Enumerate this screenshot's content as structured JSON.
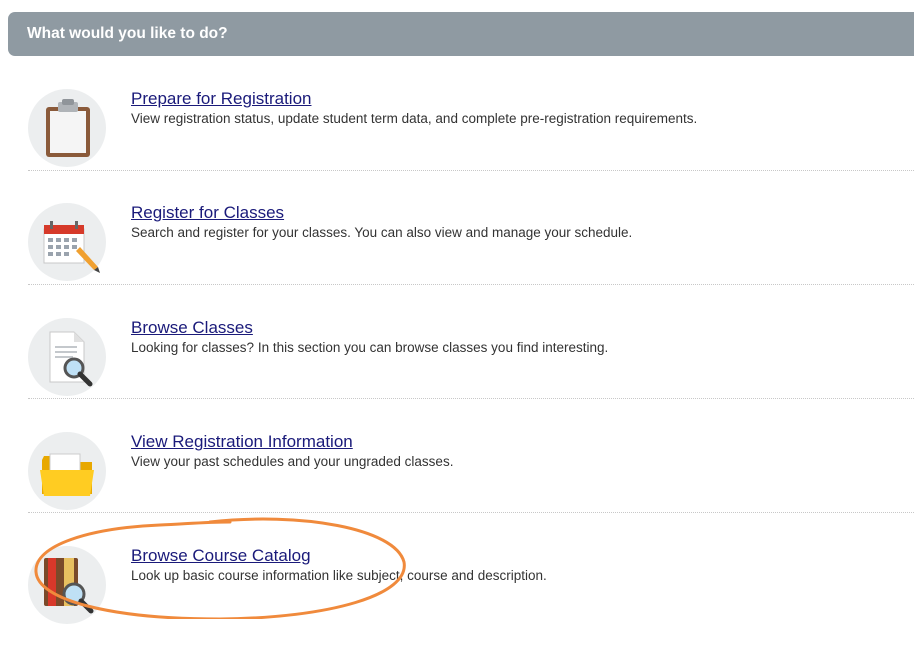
{
  "header": {
    "title": "What would you like to do?"
  },
  "items": [
    {
      "title": "Prepare for Registration",
      "description": "View registration status, update student term data, and complete pre-registration requirements.",
      "icon": "clipboard-icon"
    },
    {
      "title": "Register for Classes",
      "description": "Search and register for your classes. You can also view and manage your schedule.",
      "icon": "calendar-icon"
    },
    {
      "title": "Browse Classes",
      "description": "Looking for classes? In this section you can browse classes you find interesting.",
      "icon": "document-search-icon"
    },
    {
      "title": "View Registration Information",
      "description": "View your past schedules and your ungraded classes.",
      "icon": "folder-icon"
    },
    {
      "title": "Browse Course Catalog",
      "description": "Look up basic course information like subject, course and description.",
      "icon": "book-search-icon"
    }
  ],
  "colors": {
    "header_bg": "#8f9aa2",
    "link": "#1a1a7a",
    "annotation": "#f08a3c"
  }
}
